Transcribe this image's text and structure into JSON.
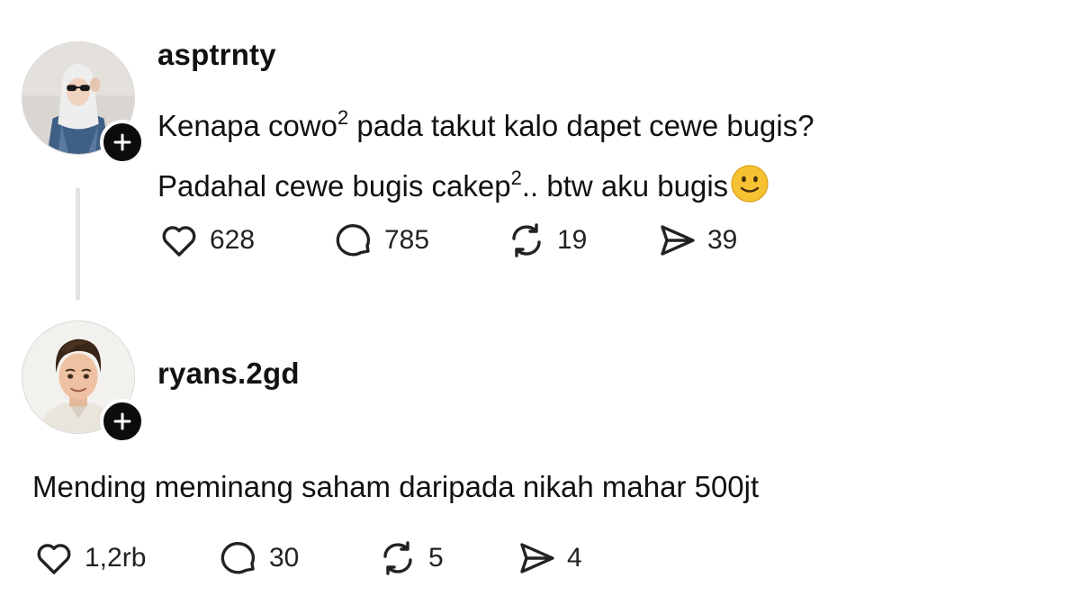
{
  "posts": [
    {
      "username": "asptrnty",
      "line1_pre": "Kenapa cowo",
      "line1_sup": "2",
      "line1_post": " pada takut kalo dapet cewe bugis?",
      "line2_pre": "Padahal cewe bugis cakep",
      "line2_sup": "2",
      "line2_post": ".. btw aku bugis",
      "emoji": "slightly-smiling-face",
      "likes": "628",
      "replies": "785",
      "reposts": "19",
      "shares": "39"
    },
    {
      "username": "ryans.2gd",
      "text": "Mending meminang saham daripada nikah mahar 500jt",
      "likes": "1,2rb",
      "replies": "30",
      "reposts": "5",
      "shares": "4"
    }
  ],
  "icons": {
    "like": "heart-icon",
    "reply": "speech-bubble-icon",
    "repost": "repost-icon",
    "share": "paper-plane-icon",
    "follow": "plus-icon"
  },
  "colors": {
    "text": "#111111",
    "follow_button": "#0c0c0c",
    "thread_line": "#e2e2e2",
    "emoji": "#f7c232"
  }
}
